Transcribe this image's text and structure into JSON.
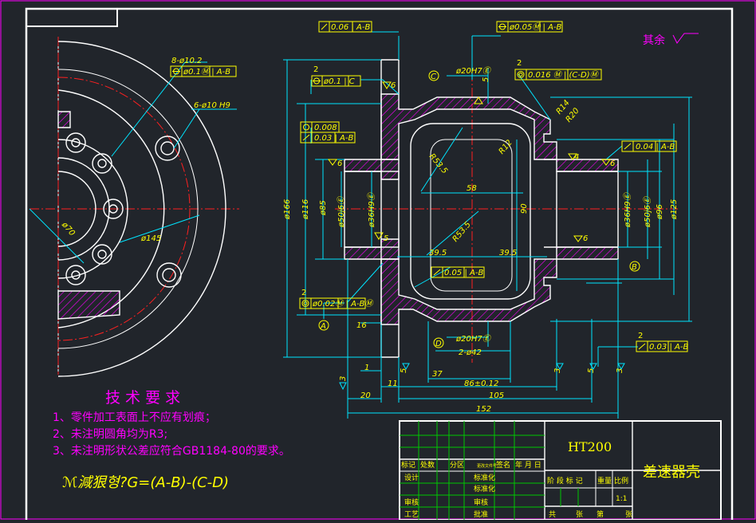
{
  "material": "HT200",
  "part_name": "差速器壳",
  "roughness_note": "其余",
  "tech_requirements": {
    "title": "技 术 要 求",
    "items": [
      "1、零件加工表面上不应有划痕；",
      "2、未注明圆角均为R3;",
      "3、未注明形状公差应符合GB1184-80的要求。"
    ]
  },
  "formula_note": "ℳ減狠형?G=(A-B)-(C-D)",
  "left_view": {
    "holes_8": "8-ø10.2",
    "holes_8_fcf": "ø0.1Ⓜ | A-B",
    "holes_6": "6-ø10 H9",
    "dia_70": "ø70",
    "dia_145": "ø145"
  },
  "fcf": {
    "top1": "0.06 | A-B",
    "top2": "ø0.05Ⓜ | A-B",
    "c_pos": "ø0.1 | C",
    "flat": "0.008",
    "circ": "0.03 | A-B",
    "c_right": "0.016 Ⓜ | (C-D)Ⓜ",
    "right": "0.04 | A-B",
    "mid": "0.05 | A-B",
    "bot_left": "ø0.02Ⓜ | A-BⓂ",
    "bot_right": "0.03 | A-B"
  },
  "labels": {
    "datum_a": "A",
    "datum_b": "B",
    "datum_c": "C",
    "datum_d": "D",
    "bore_c": "ø20H7Ⓔ",
    "bore_d": "ø20H7Ⓔ",
    "r14": "R14",
    "r20": "R20",
    "r12": "R12",
    "r53": "R53.5",
    "r53b": "R53.5",
    "d58": "58",
    "d90": "90",
    "d395a": "39.5",
    "d395b": "39.5",
    "d2x42": "2-ø42",
    "d37": "37",
    "d86": "86±0.12",
    "d105": "105",
    "d152": "152",
    "d16": "16",
    "d20": "20",
    "d11": "11",
    "d1": "1",
    "d3": "3",
    "d5": "5",
    "d4": "4",
    "d6": "6",
    "dia166": "ø166",
    "dia116": "ø116",
    "dia85": "ø85",
    "dia50": "ø50j6Ⓔ",
    "dia36": "ø36H9Ⓔ",
    "dia36r": "ø36H9Ⓔ",
    "dia50r": "ø50j6Ⓔ",
    "dia96": "ø96",
    "dia125": "ø125"
  },
  "title_block": {
    "r1": [
      "标记",
      "处数",
      "分区",
      "更改文件号",
      "签名",
      "年 月 日"
    ],
    "design": "设计",
    "std": "标准化",
    "check": "审核",
    "process": "工艺",
    "approve": "批准",
    "stage_mark": "阶 段 标 记",
    "weight": "重量",
    "scale": "比例",
    "scale_val": "1:1",
    "sheets_total": "共",
    "sheet_unit": "张",
    "sheet_no": "第"
  }
}
